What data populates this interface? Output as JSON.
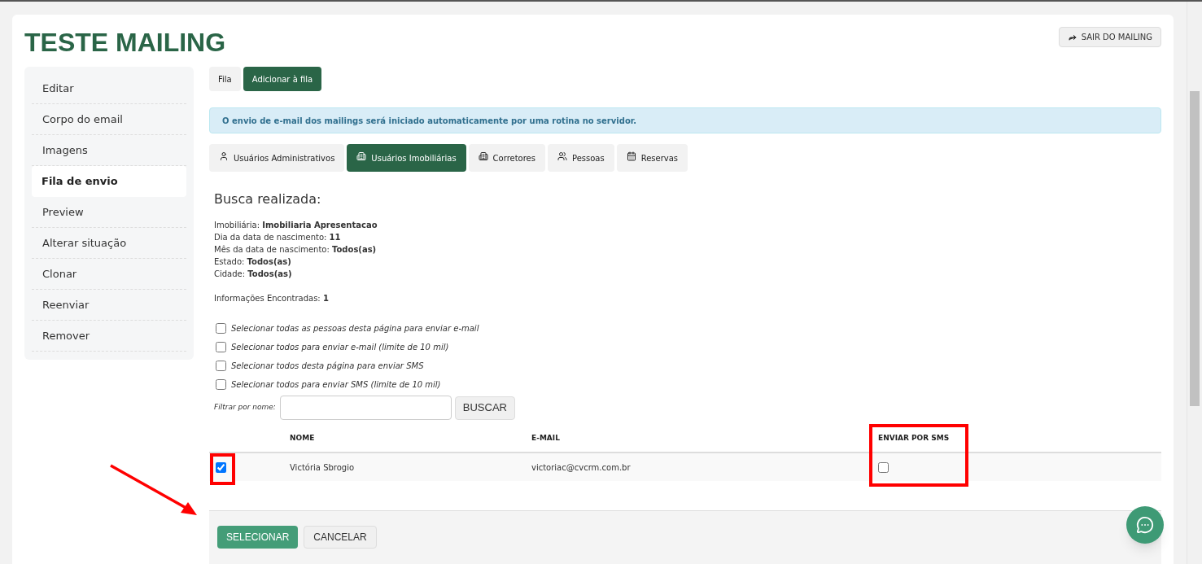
{
  "title": "TESTE MAILING",
  "exit_button": "SAIR DO MAILING",
  "sidebar": {
    "items": [
      {
        "label": "Editar",
        "selected": false
      },
      {
        "label": "Corpo do email",
        "selected": false
      },
      {
        "label": "Imagens",
        "selected": false
      },
      {
        "label": "Fila de envio",
        "selected": true
      },
      {
        "label": "Preview",
        "selected": false
      },
      {
        "label": "Alterar situação",
        "selected": false
      },
      {
        "label": "Clonar",
        "selected": false
      },
      {
        "label": "Reenviar",
        "selected": false
      },
      {
        "label": "Remover",
        "selected": false
      }
    ]
  },
  "queue_tabs": [
    {
      "label": "Fila",
      "selected": false
    },
    {
      "label": "Adicionar à fila",
      "selected": true
    }
  ],
  "alert": "O envio de e-mail dos mailings será iniciado automaticamente por uma rotina no servidor.",
  "audience_tabs": [
    {
      "label": "Usuários Administrativos",
      "kind": "user",
      "selected": false
    },
    {
      "label": "Usuários Imobiliárias",
      "kind": "building",
      "selected": true
    },
    {
      "label": "Corretores",
      "kind": "building",
      "selected": false
    },
    {
      "label": "Pessoas",
      "kind": "group",
      "selected": false
    },
    {
      "label": "Reservas",
      "kind": "calendar",
      "selected": false
    }
  ],
  "search_summary": {
    "heading": "Busca realizada:",
    "criteria": [
      "Imobiliária: **Imobiliaria Apresentacao**",
      "Dia da data de nascimento: **11**",
      "Mês da data de nascimento: **Todos(as)**",
      "Estado: **Todos(as)**",
      "Cidade: **Todos(as)**"
    ],
    "found": "Informações Encontradas: **1**"
  },
  "select_options": [
    {
      "label": "Selecionar todas as pessoas desta página para enviar e-mail",
      "checked": false
    },
    {
      "label": "Selecionar todos para enviar e-mail (limite de 10 mil)",
      "checked": false
    },
    {
      "label": "Selecionar todos desta página para enviar SMS",
      "checked": false
    },
    {
      "label": "Selecionar todos para enviar SMS (limite de 10 mil)",
      "checked": false
    }
  ],
  "filter": {
    "label": "Filtrar por nome:",
    "button": "BUSCAR"
  },
  "table": {
    "columns": [
      "NOME",
      "E-MAIL",
      "ENVIAR POR SMS"
    ],
    "rows": [
      {
        "selected": true,
        "name": "Victória Sbrogio",
        "email": "victoriac@cvcrm.com.br",
        "send_sms": false
      }
    ]
  },
  "footer_buttons": [
    {
      "label": "SELECIONAR",
      "kind": "primary"
    },
    {
      "label": "CANCELAR",
      "kind": "secondary"
    }
  ]
}
